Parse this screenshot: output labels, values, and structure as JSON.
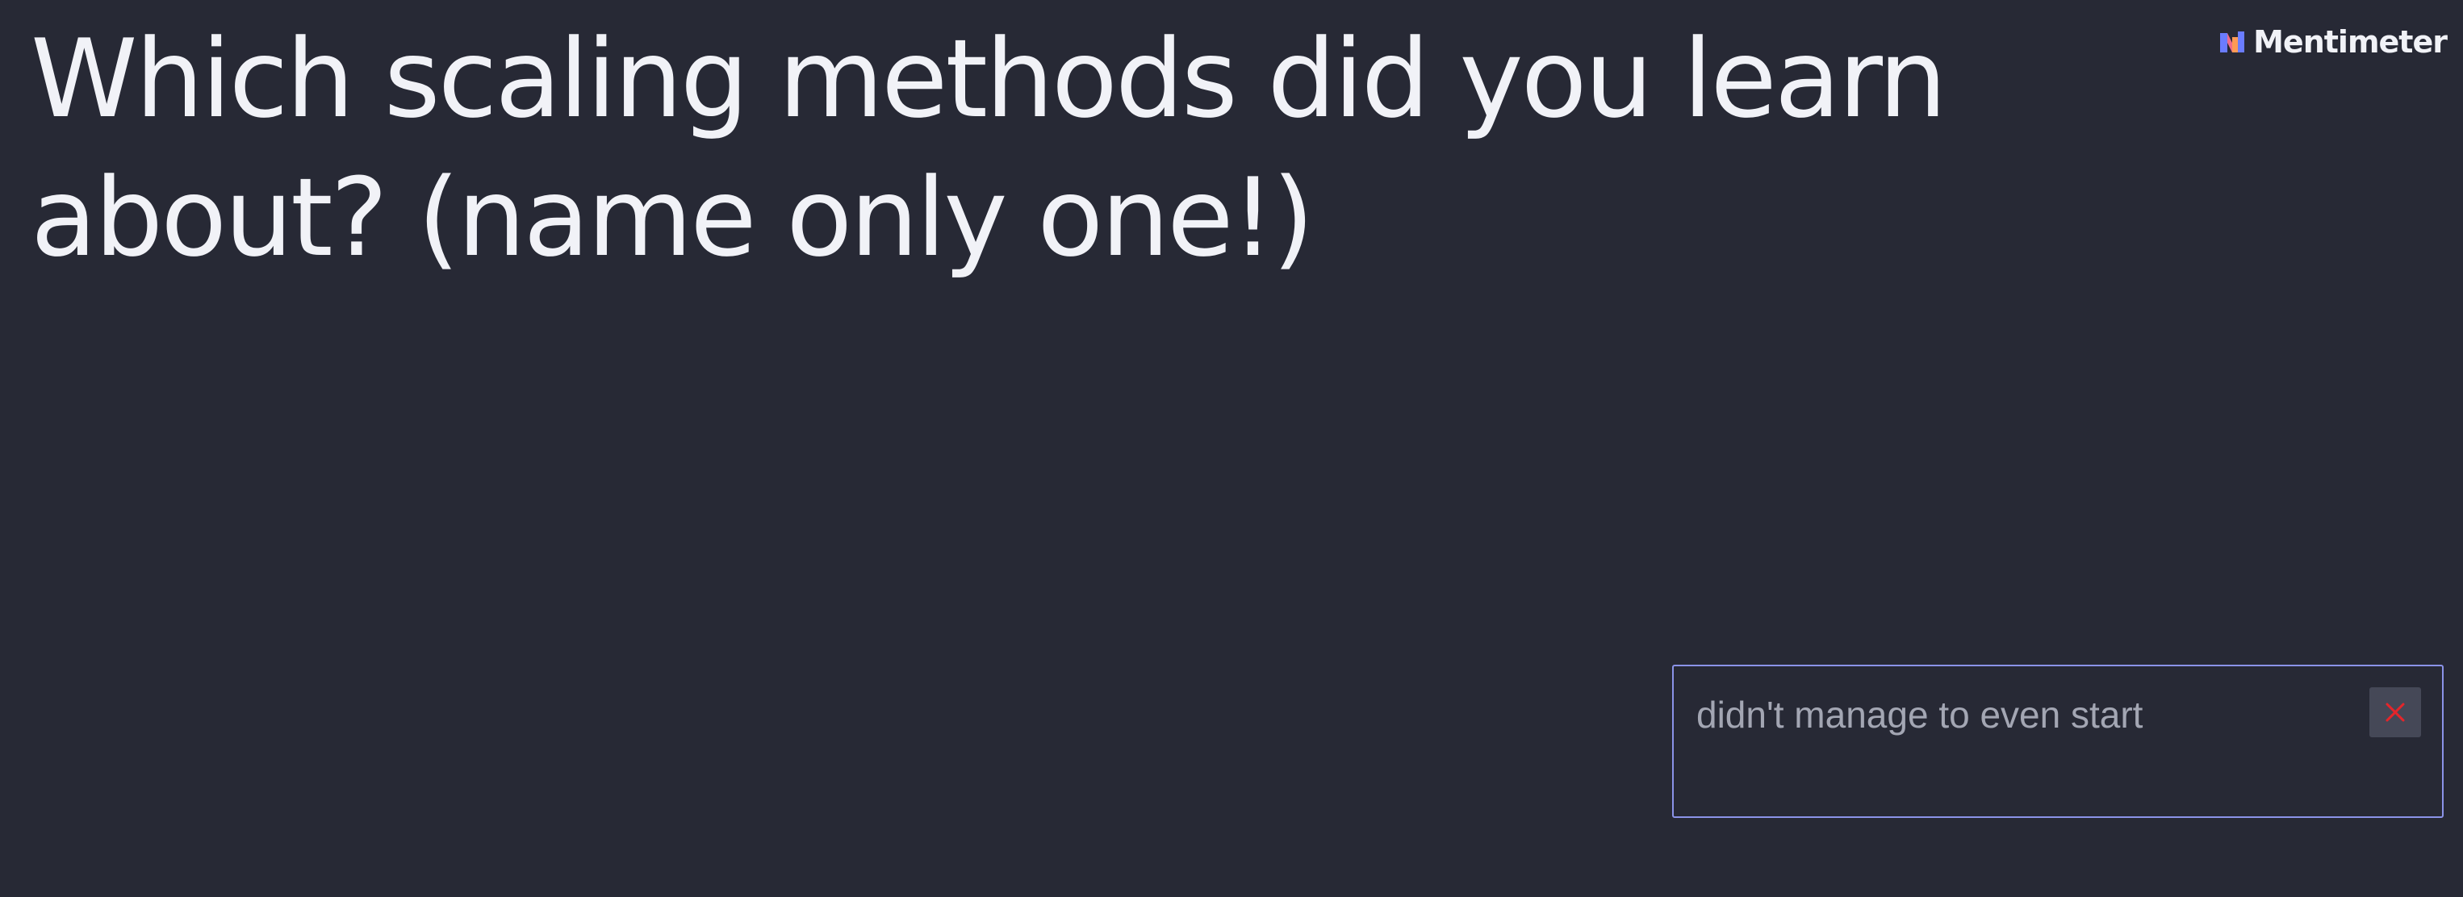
{
  "question": {
    "title": "Which scaling methods did you learn about? (name only one!)"
  },
  "brand": {
    "name": "Mentimeter",
    "logo_icon": "mentimeter-logo-icon",
    "logo_colors": [
      "#6a7cff",
      "#f06b8b",
      "#ff9a55"
    ]
  },
  "response": {
    "text": "didn't manage to even start",
    "remove_icon": "close-icon",
    "remove_icon_color": "#e5252a",
    "border_color": "#8b93e8"
  },
  "colors": {
    "background": "#272935",
    "text": "#f1f2f7"
  }
}
